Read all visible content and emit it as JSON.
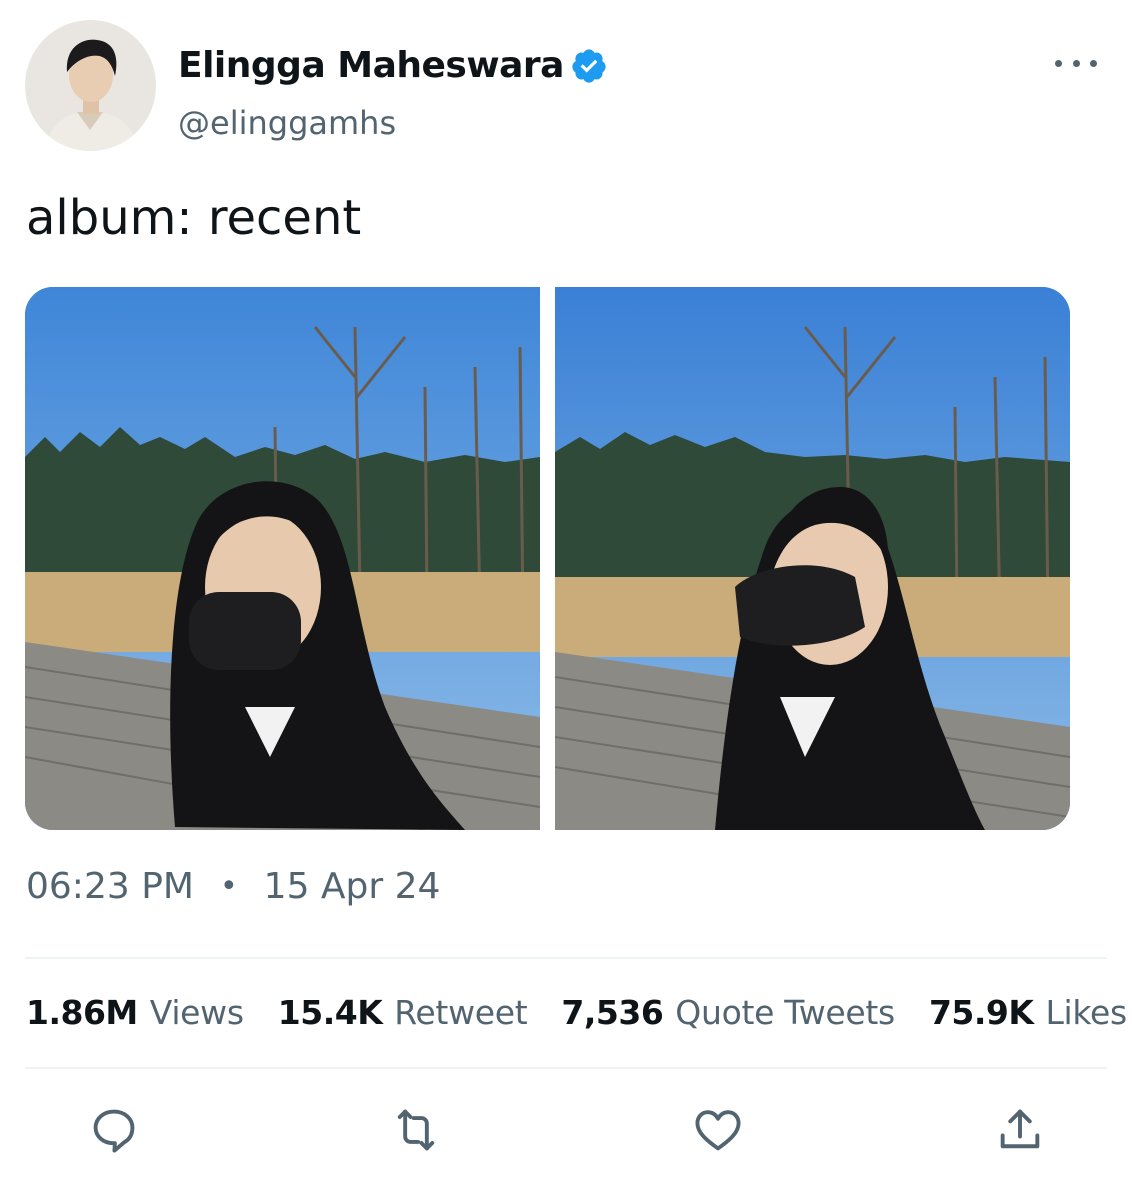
{
  "author": {
    "display_name": "Elingga Maheswara",
    "handle": "@elinggamhs",
    "verified": true,
    "verified_color": "#1d9bf0"
  },
  "tweet": {
    "text": "album: recent",
    "time": "06:23 PM",
    "separator": "•",
    "date": "15 Apr 24"
  },
  "stats": [
    {
      "value": "1.86M",
      "label": "Views"
    },
    {
      "value": "15.4K",
      "label": "Retweet"
    },
    {
      "value": "7,536",
      "label": "Quote Tweets"
    },
    {
      "value": "75.9K",
      "label": "Likes"
    }
  ],
  "actions": [
    {
      "icon": "reply-icon"
    },
    {
      "icon": "retweet-icon"
    },
    {
      "icon": "like-icon"
    },
    {
      "icon": "share-icon"
    }
  ],
  "colors": {
    "text_primary": "#0f1419",
    "text_secondary": "#536471",
    "divider": "#eff3f4"
  }
}
